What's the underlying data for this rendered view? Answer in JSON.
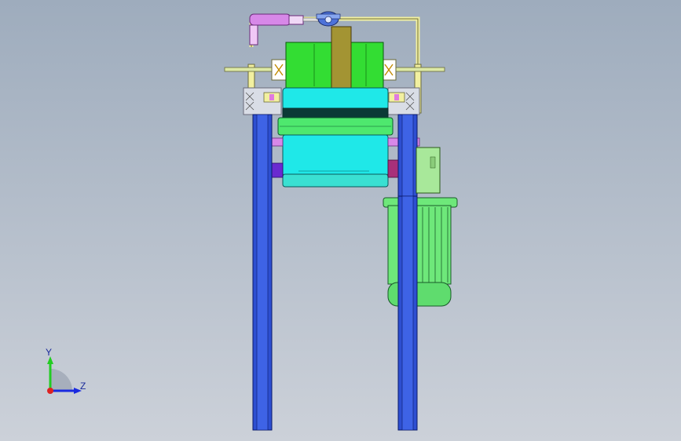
{
  "scene": {
    "background_top": "#9eacbd",
    "background_bottom": "#ccd1d9",
    "parts": {
      "frame_color": "#2d4fd1",
      "roller_color": "#1fe8e8",
      "drum_color": "#33dd33",
      "motor_color": "#6ee87a",
      "gearbox_color": "#a8e89a",
      "hopper_color": "#a39433",
      "bracket_color": "#f2f0a0",
      "cylinder_color": "#d788e8",
      "shaft_color": "#dde9a6"
    }
  },
  "triad": {
    "y_label": "Y",
    "z_label": "Z",
    "y_color": "#22cc22",
    "z_color": "#1a2ae0",
    "x_color": "#dd2222"
  }
}
